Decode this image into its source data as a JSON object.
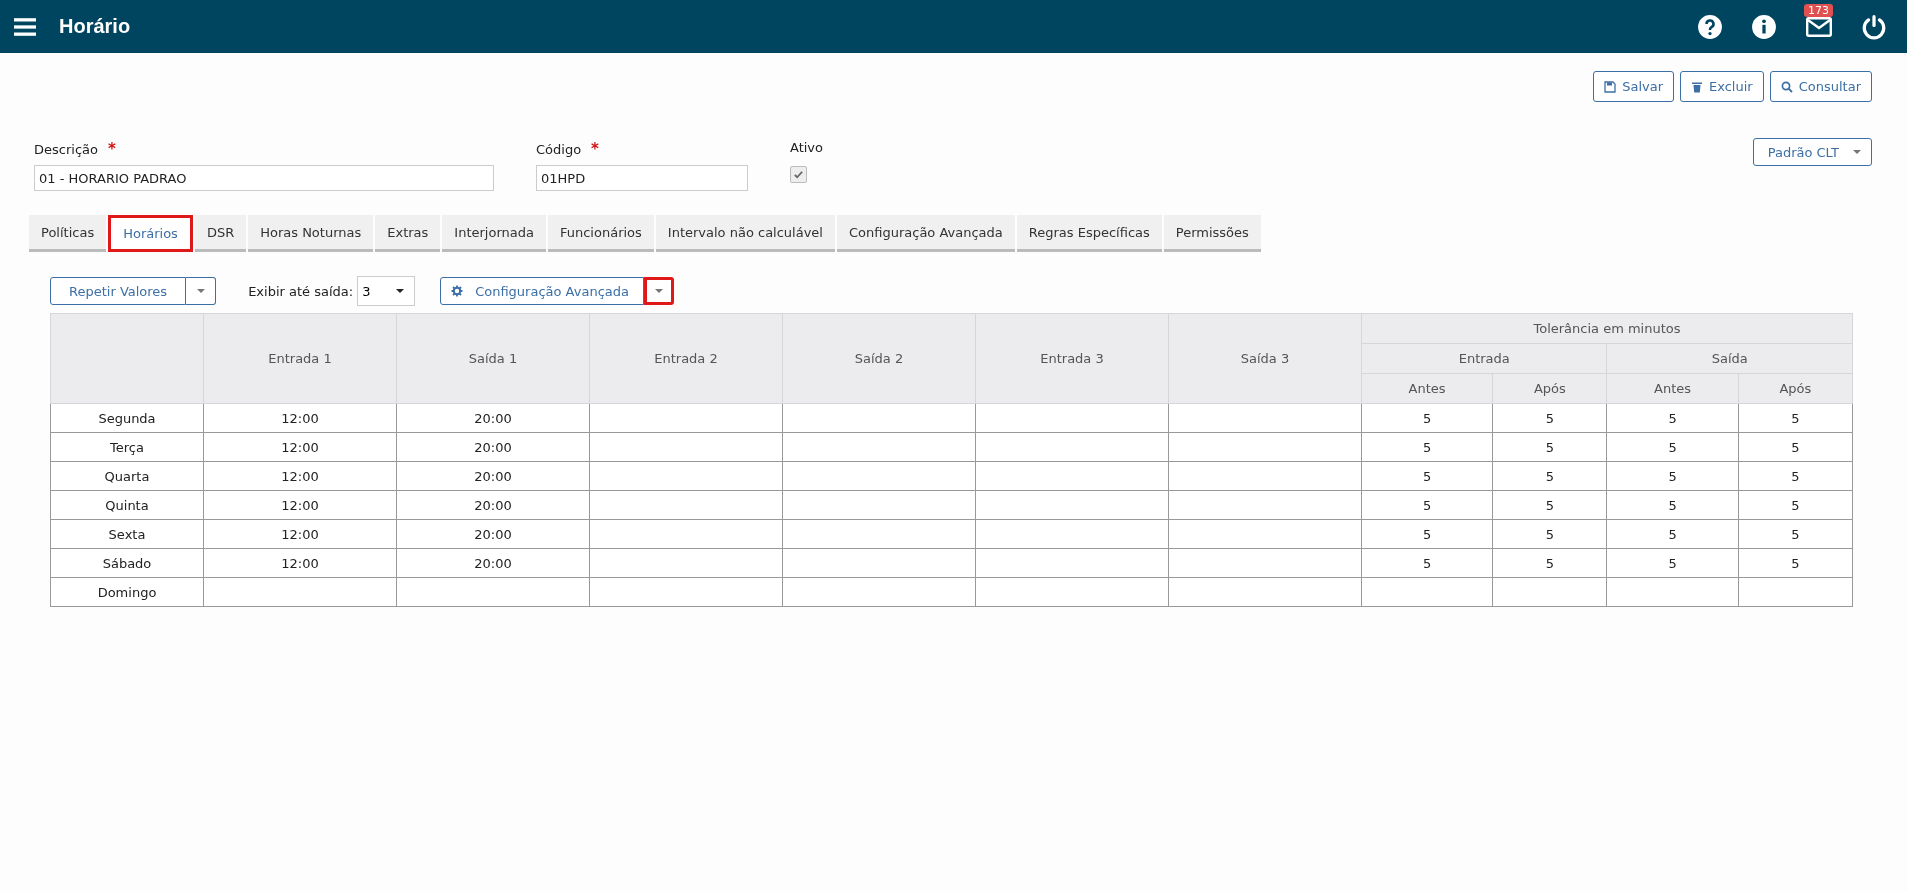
{
  "header": {
    "title": "Horário",
    "badge": "173"
  },
  "actions": [
    "Salvar",
    "Excluir",
    "Consultar"
  ],
  "form": {
    "descricao": {
      "label": "Descrição",
      "required_mark": "*",
      "value": "01 - HORARIO PADRAO"
    },
    "codigo": {
      "label": "Código",
      "required_mark": "*",
      "value": "01HPD"
    },
    "ativo": {
      "label": "Ativo",
      "checked": true
    },
    "preset": "Padrão CLT"
  },
  "tabs": [
    {
      "label": "Políticas",
      "selected": false
    },
    {
      "label": "Horários",
      "selected": true
    },
    {
      "label": "DSR",
      "selected": false
    },
    {
      "label": "Horas Noturnas",
      "selected": false
    },
    {
      "label": "Extras",
      "selected": false
    },
    {
      "label": "Interjornada",
      "selected": false
    },
    {
      "label": "Funcionários",
      "selected": false
    },
    {
      "label": "Intervalo não calculável",
      "selected": false
    },
    {
      "label": "Configuração Avançada",
      "selected": false
    },
    {
      "label": "Regras Específicas",
      "selected": false
    },
    {
      "label": "Permissões",
      "selected": false
    }
  ],
  "toolbar": {
    "repeat": "Repetir Valores",
    "show_label": "Exibir até saída:",
    "show_value": "3",
    "config": "Configuração Avançada",
    "config_caret_highlighted": true
  },
  "table": {
    "columns": [
      "Entrada 1",
      "Saída 1",
      "Entrada 2",
      "Saída 2",
      "Entrada 3",
      "Saída 3"
    ],
    "tolerance": "Tolerância em minutos",
    "groups": [
      "Entrada",
      "Saída"
    ],
    "subcolumns": [
      "Antes",
      "Após",
      "Antes",
      "Após"
    ],
    "rows": [
      {
        "day": "Segunda",
        "cells": [
          "12:00",
          "20:00",
          "",
          "",
          "",
          "",
          "5",
          "5",
          "5",
          "5"
        ]
      },
      {
        "day": "Terça",
        "cells": [
          "12:00",
          "20:00",
          "",
          "",
          "",
          "",
          "5",
          "5",
          "5",
          "5"
        ]
      },
      {
        "day": "Quarta",
        "cells": [
          "12:00",
          "20:00",
          "",
          "",
          "",
          "",
          "5",
          "5",
          "5",
          "5"
        ]
      },
      {
        "day": "Quinta",
        "cells": [
          "12:00",
          "20:00",
          "",
          "",
          "",
          "",
          "5",
          "5",
          "5",
          "5"
        ]
      },
      {
        "day": "Sexta",
        "cells": [
          "12:00",
          "20:00",
          "",
          "",
          "",
          "",
          "5",
          "5",
          "5",
          "5"
        ]
      },
      {
        "day": "Sábado",
        "cells": [
          "12:00",
          "20:00",
          "",
          "",
          "",
          "",
          "5",
          "5",
          "5",
          "5"
        ]
      },
      {
        "day": "Domingo",
        "cells": [
          "",
          "",
          "",
          "",
          "",
          "",
          "",
          "",
          "",
          ""
        ]
      }
    ]
  }
}
